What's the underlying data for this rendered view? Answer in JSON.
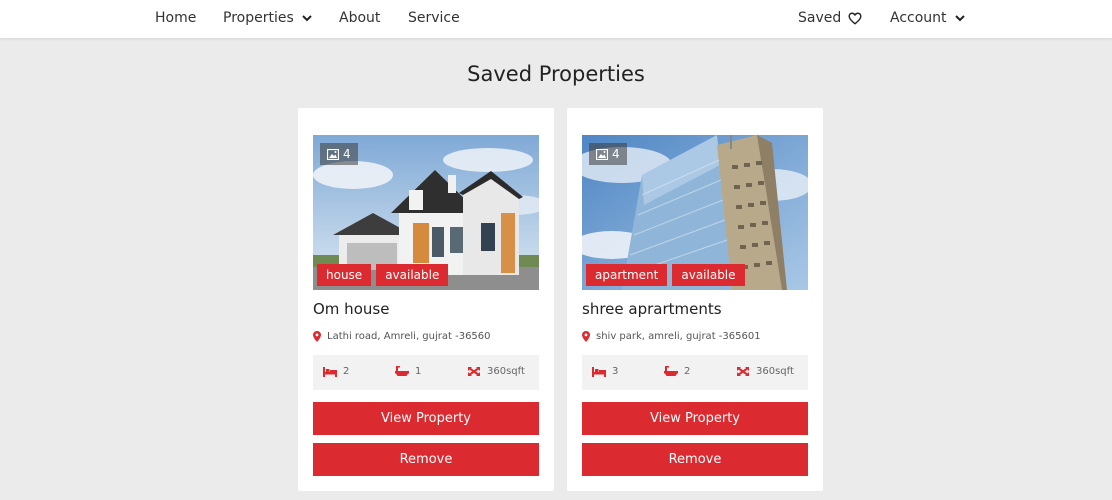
{
  "colors": {
    "accent": "#dc2b30",
    "background": "#ebebeb",
    "nav_bg": "#ffffff"
  },
  "nav": {
    "home": "Home",
    "properties": "Properties",
    "about": "About",
    "service": "Service",
    "saved": "Saved",
    "account": "Account"
  },
  "page_title": "Saved Properties",
  "properties": [
    {
      "image_count": "4",
      "tags": [
        "house",
        "available"
      ],
      "title": "Om house",
      "address": "Lathi road, Amreli, gujrat -36560",
      "bedrooms": "2",
      "bathrooms": "1",
      "area": "360sqft",
      "view_label": "View Property",
      "remove_label": "Remove"
    },
    {
      "image_count": "4",
      "tags": [
        "apartment",
        "available"
      ],
      "title": "shree aprartments",
      "address": "shiv park, amreli, gujrat -365601",
      "bedrooms": "3",
      "bathrooms": "2",
      "area": "360sqft",
      "view_label": "View Property",
      "remove_label": "Remove"
    }
  ]
}
